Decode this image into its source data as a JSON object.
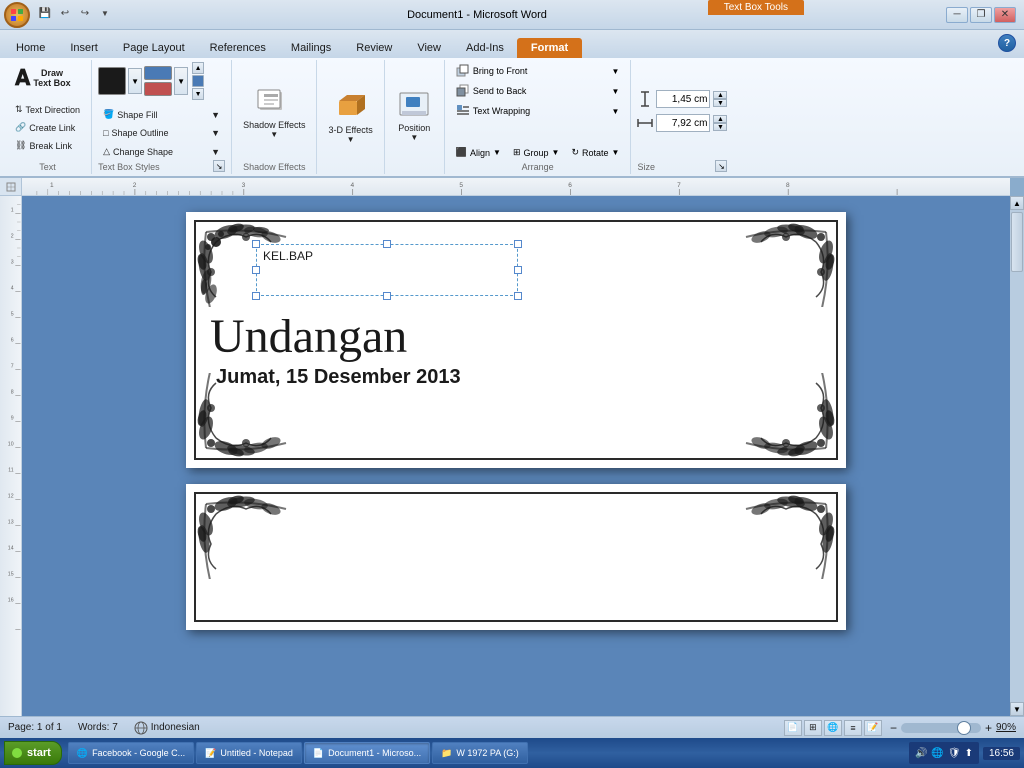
{
  "window": {
    "title": "Document1 - Microsoft Word",
    "contextual_tab": "Text Box Tools",
    "minimize": "─",
    "restore": "❐",
    "close": "✕"
  },
  "tabs": [
    {
      "id": "home",
      "label": "Home"
    },
    {
      "id": "insert",
      "label": "Insert"
    },
    {
      "id": "pagelayout",
      "label": "Page Layout"
    },
    {
      "id": "references",
      "label": "References"
    },
    {
      "id": "mailings",
      "label": "Mailings"
    },
    {
      "id": "review",
      "label": "Review"
    },
    {
      "id": "view",
      "label": "View"
    },
    {
      "id": "addins",
      "label": "Add-Ins"
    },
    {
      "id": "format",
      "label": "Format",
      "active": true
    }
  ],
  "ribbon": {
    "groups": {
      "text": {
        "label": "Text",
        "draw_text_box": "Draw\nText Box",
        "text_direction": "Text Direction",
        "create_link": "Create Link",
        "break_link": "Break Link"
      },
      "text_box_styles": {
        "label": "Text Box Styles",
        "shape_fill": "Shape Fill",
        "shape_outline": "Shape Outline",
        "change_shape": "Change Shape",
        "colors": [
          "#1a1a1a",
          "#4a7ab5",
          "#c05050"
        ]
      },
      "shadow_effects": {
        "label": "Shadow Effects",
        "shadow_effects_btn": "Shadow Effects"
      },
      "effects_3d": {
        "label": "",
        "btn": "3-D Effects"
      },
      "position_btn": {
        "label": "",
        "btn": "Position"
      },
      "arrange": {
        "label": "Arrange",
        "bring_to_front": "Bring to Front",
        "send_to_back": "Send to Back",
        "text_wrapping": "Text Wrapping",
        "align": "Align",
        "group": "Group",
        "rotate": "Rotate"
      },
      "size": {
        "label": "Size",
        "height_label": "h",
        "height_value": "1,45 cm",
        "width_label": "w",
        "width_value": "7,92 cm"
      }
    }
  },
  "document": {
    "text_box_content": "KEL.BAP",
    "undangan_text": "Undangan",
    "date_text": "Jumat, 15 Desember 2013"
  },
  "status_bar": {
    "page": "Page: 1 of 1",
    "words": "Words: 7",
    "language": "Indonesian",
    "zoom": "90%"
  },
  "taskbar": {
    "start": "start",
    "items": [
      {
        "label": "Facebook - Google C...",
        "icon": "🌐"
      },
      {
        "label": "Untitled - Notepad",
        "icon": "📝"
      },
      {
        "label": "Document1 - Microso...",
        "icon": "📄",
        "active": true
      },
      {
        "label": "W 1972 PA (G:)",
        "icon": "📁"
      }
    ],
    "time": "16:56"
  }
}
